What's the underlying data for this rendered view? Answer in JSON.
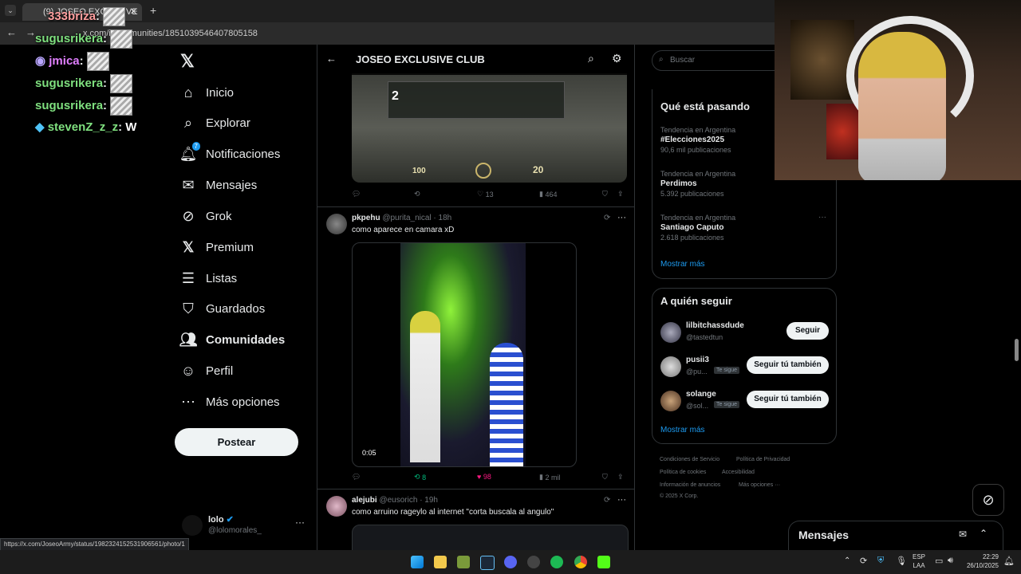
{
  "browser": {
    "tab_title": "(9) JOSEO EXCLUSIVE",
    "url": "x.com/i/communities/1851039546407805158",
    "status_url": "https://x.com/JoseoArmy/status/1982324152531906561/photo/1"
  },
  "chat": [
    {
      "user": "333briza",
      "text": "",
      "color": "#ff7f7f"
    },
    {
      "user": "sugusrikera",
      "text": "",
      "color": "#7fe07f"
    },
    {
      "user": "jmica",
      "text": "",
      "color": "#e07fff"
    },
    {
      "user": "sugusrikera",
      "text": "",
      "color": "#7fe07f"
    },
    {
      "user": "sugusrikera",
      "text": "",
      "color": "#7fe07f"
    },
    {
      "user": "stevenZ_z_z",
      "text": "W",
      "color": "#7fe07f"
    }
  ],
  "nav": {
    "items": [
      {
        "label": "Inicio",
        "icon": "home-icon"
      },
      {
        "label": "Explorar",
        "icon": "search-icon"
      },
      {
        "label": "Notificaciones",
        "icon": "bell-icon",
        "badge": "7"
      },
      {
        "label": "Mensajes",
        "icon": "mail-icon"
      },
      {
        "label": "Grok",
        "icon": "grok-icon"
      },
      {
        "label": "Premium",
        "icon": "x-logo-icon"
      },
      {
        "label": "Listas",
        "icon": "list-icon"
      },
      {
        "label": "Guardados",
        "icon": "bookmark-icon"
      },
      {
        "label": "Comunidades",
        "icon": "people-icon"
      },
      {
        "label": "Perfil",
        "icon": "person-icon"
      },
      {
        "label": "Más opciones",
        "icon": "more-circle-icon"
      }
    ],
    "post_button": "Postear",
    "account": {
      "name": "lolo",
      "handle": "@lolomorales_"
    }
  },
  "community": {
    "title": "JOSEO EXCLUSIVE CLUB"
  },
  "posts": [
    {
      "actions": {
        "replies": "",
        "reposts": "",
        "likes": "13",
        "views": "464"
      },
      "game_hud": {
        "ammo": "100",
        "rounds": "20",
        "score": "2"
      }
    },
    {
      "user": "pkpehu",
      "handle": "@purita_nical",
      "time": "· 18h",
      "text": "como aparece en camara xD",
      "video_duration": "0:05",
      "actions": {
        "replies": "",
        "reposts": "8",
        "likes": "98",
        "views": "2 mil"
      }
    },
    {
      "user": "alejubi",
      "handle": "@eusorich",
      "time": "· 19h",
      "text": "como arruino rageylo al internet \"corta buscala al angulo\""
    }
  ],
  "search": {
    "placeholder": "Buscar"
  },
  "trends": {
    "title": "Qué está pasando",
    "items": [
      {
        "category": "Tendencia en Argentina",
        "name": "#Elecciones2025",
        "count": "90,6 mil publicaciones"
      },
      {
        "category": "Tendencia en Argentina",
        "name": "Perdimos",
        "count": "5.392 publicaciones"
      },
      {
        "category": "Tendencia en Argentina",
        "name": "Santiago Caputo",
        "count": "2.618 publicaciones"
      }
    ],
    "show_more": "Mostrar más"
  },
  "who_to_follow": {
    "title": "A quién seguir",
    "items": [
      {
        "name": "lilbitchassdude",
        "handle": "@tastedtun",
        "badge": "",
        "button": "Seguir"
      },
      {
        "name": "pusii3",
        "handle": "@pu...",
        "badge": "Te sigue",
        "button": "Seguir tú también"
      },
      {
        "name": "solange",
        "handle": "@sol...",
        "badge": "Te sigue",
        "button": "Seguir tú también"
      }
    ],
    "show_more": "Mostrar más"
  },
  "footer": {
    "links": [
      "Condiciones de Servicio",
      "Política de Privacidad",
      "Política de cookies",
      "Accesibilidad",
      "Información de anuncios",
      "Más opciones ···"
    ],
    "copyright": "© 2025 X Corp."
  },
  "messages_bar": {
    "title": "Mensajes"
  },
  "taskbar": {
    "lang": "ESP",
    "lang2": "LAA",
    "time": "22:29",
    "date": "26/10/2025"
  },
  "colors": {
    "accent": "#1d9bf0",
    "like": "#f91880",
    "repost": "#00ba7c"
  }
}
